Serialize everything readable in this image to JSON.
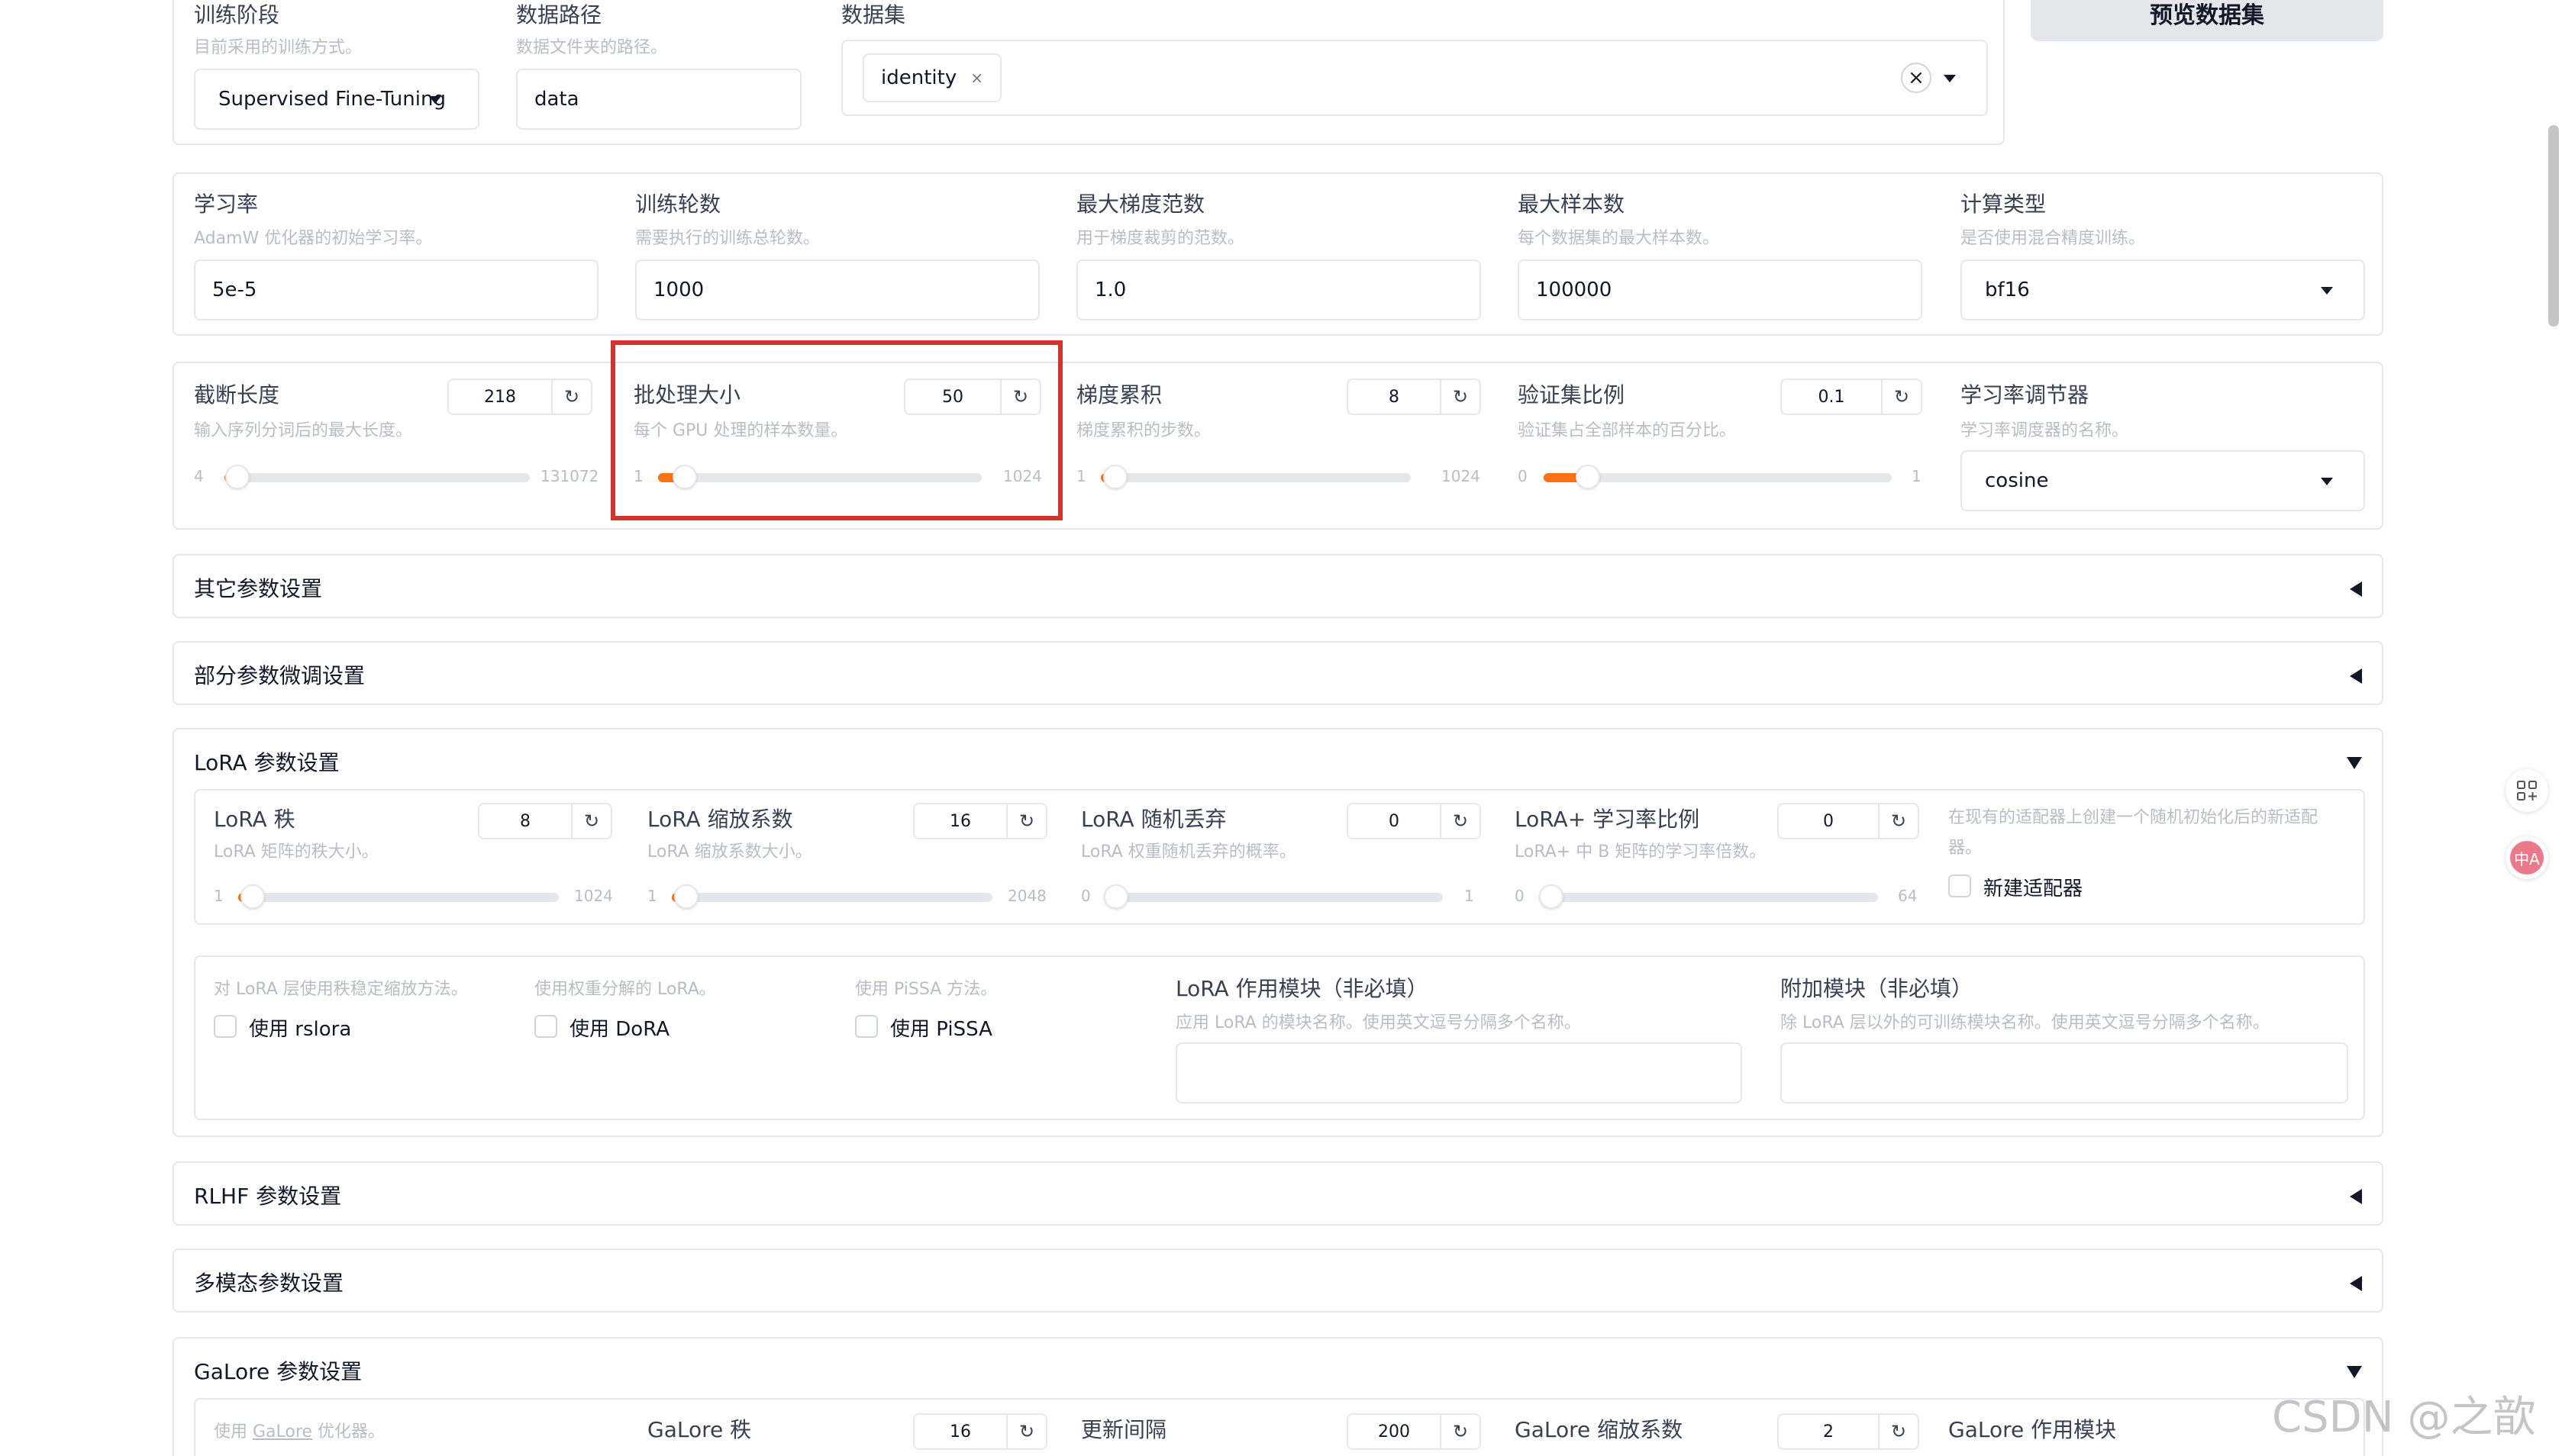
{
  "top": {
    "stage": {
      "label": "训练阶段",
      "hint": "目前采用的训练方式。",
      "value": "Supervised Fine-Tuning"
    },
    "data_dir": {
      "label": "数据路径",
      "hint": "数据文件夹的路径。",
      "value": "data"
    },
    "dataset": {
      "label": "数据集",
      "chip": "identity"
    },
    "preview_button": "预览数据集"
  },
  "params1": {
    "learning_rate": {
      "label": "学习率",
      "hint": "AdamW 优化器的初始学习率。",
      "value": "5e-5"
    },
    "epochs": {
      "label": "训练轮数",
      "hint": "需要执行的训练总轮数。",
      "value": "1000"
    },
    "max_grad_norm": {
      "label": "最大梯度范数",
      "hint": "用于梯度裁剪的范数。",
      "value": "1.0"
    },
    "max_samples": {
      "label": "最大样本数",
      "hint": "每个数据集的最大样本数。",
      "value": "100000"
    },
    "compute_type": {
      "label": "计算类型",
      "hint": "是否使用混合精度训练。",
      "value": "bf16"
    }
  },
  "params2": {
    "cutoff_len": {
      "label": "截断长度",
      "hint": "输入序列分词后的最大长度。",
      "value": "218",
      "min": "4",
      "max": "131072",
      "ratio": 0.0017
    },
    "batch_size": {
      "label": "批处理大小",
      "hint": "每个 GPU 处理的样本数量。",
      "value": "50",
      "min": "1",
      "max": "1024",
      "ratio": 0.048
    },
    "grad_accum": {
      "label": "梯度累积",
      "hint": "梯度累积的步数。",
      "value": "8",
      "min": "1",
      "max": "1024",
      "ratio": 0.007
    },
    "val_size": {
      "label": "验证集比例",
      "hint": "验证集占全部样本的百分比。",
      "value": "0.1",
      "min": "0",
      "max": "1",
      "ratio": 0.1
    },
    "lr_scheduler": {
      "label": "学习率调节器",
      "hint": "学习率调度器的名称。",
      "value": "cosine"
    }
  },
  "accordions": {
    "other": "其它参数设置",
    "freeze": "部分参数微调设置",
    "lora": "LoRA 参数设置",
    "rlhf": "RLHF 参数设置",
    "multimodal": "多模态参数设置",
    "galore": "GaLore 参数设置"
  },
  "lora": {
    "rank": {
      "label": "LoRA 秩",
      "hint": "LoRA 矩阵的秩大小。",
      "value": "8",
      "min": "1",
      "max": "1024",
      "ratio": 0.007
    },
    "alpha": {
      "label": "LoRA 缩放系数",
      "hint": "LoRA 缩放系数大小。",
      "value": "16",
      "min": "1",
      "max": "2048",
      "ratio": 0.007
    },
    "dropout": {
      "label": "LoRA 随机丢弃",
      "hint": "LoRA 权重随机丢弃的概率。",
      "value": "0",
      "min": "0",
      "max": "1",
      "ratio": 0
    },
    "plus_ratio": {
      "label": "LoRA+ 学习率比例",
      "hint": "LoRA+ 中 B 矩阵的学习率倍数。",
      "value": "0",
      "min": "0",
      "max": "64",
      "ratio": 0
    },
    "new_adapter": {
      "hint": "在现有的适配器上创建一个随机初始化后的新适配器。",
      "label": "新建适配器"
    },
    "rslora": {
      "hint": "对 LoRA 层使用秩稳定缩放方法。",
      "label": "使用 rslora"
    },
    "dora": {
      "hint": "使用权重分解的 LoRA。",
      "label": "使用 DoRA"
    },
    "pissa": {
      "hint": "使用 PiSSA 方法。",
      "label": "使用 PiSSA"
    },
    "target": {
      "label": "LoRA 作用模块（非必填）",
      "hint": "应用 LoRA 的模块名称。使用英文逗号分隔多个名称。"
    },
    "additional": {
      "label": "附加模块（非必填）",
      "hint": "除 LoRA 层以外的可训练模块名称。使用英文逗号分隔多个名称。"
    }
  },
  "galore": {
    "use": {
      "hint_prefix": "使用 ",
      "hint_link": "GaLore",
      "hint_suffix": " 优化器。"
    },
    "rank": {
      "label": "GaLore 秩",
      "value": "16"
    },
    "interval": {
      "label": "更新间隔",
      "value": "200"
    },
    "scale": {
      "label": "GaLore 缩放系数",
      "value": "2"
    },
    "target": {
      "label": "GaLore 作用模块"
    }
  },
  "watermark": "CSDN @之歆",
  "side_icons": [
    "grid-plus-icon",
    "translate-icon"
  ]
}
